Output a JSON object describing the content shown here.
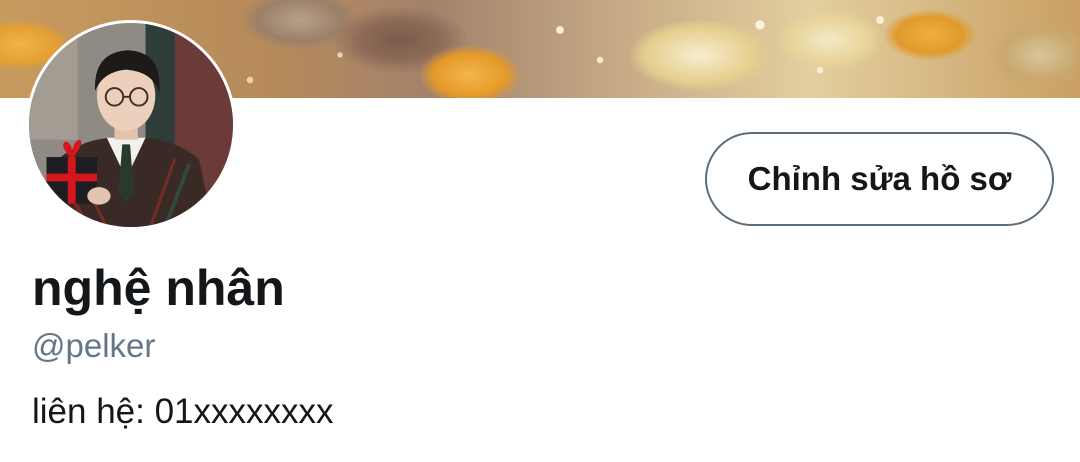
{
  "profile": {
    "display_name": "nghệ nhân",
    "handle": "@pelker",
    "bio": "liên hệ: 01xxxxxxxx",
    "edit_button_label": "Chỉnh sửa hồ sơ"
  },
  "colors": {
    "text_primary": "#14171a",
    "text_secondary": "#657786",
    "button_border": "#5a6e7c",
    "background": "#ffffff"
  }
}
